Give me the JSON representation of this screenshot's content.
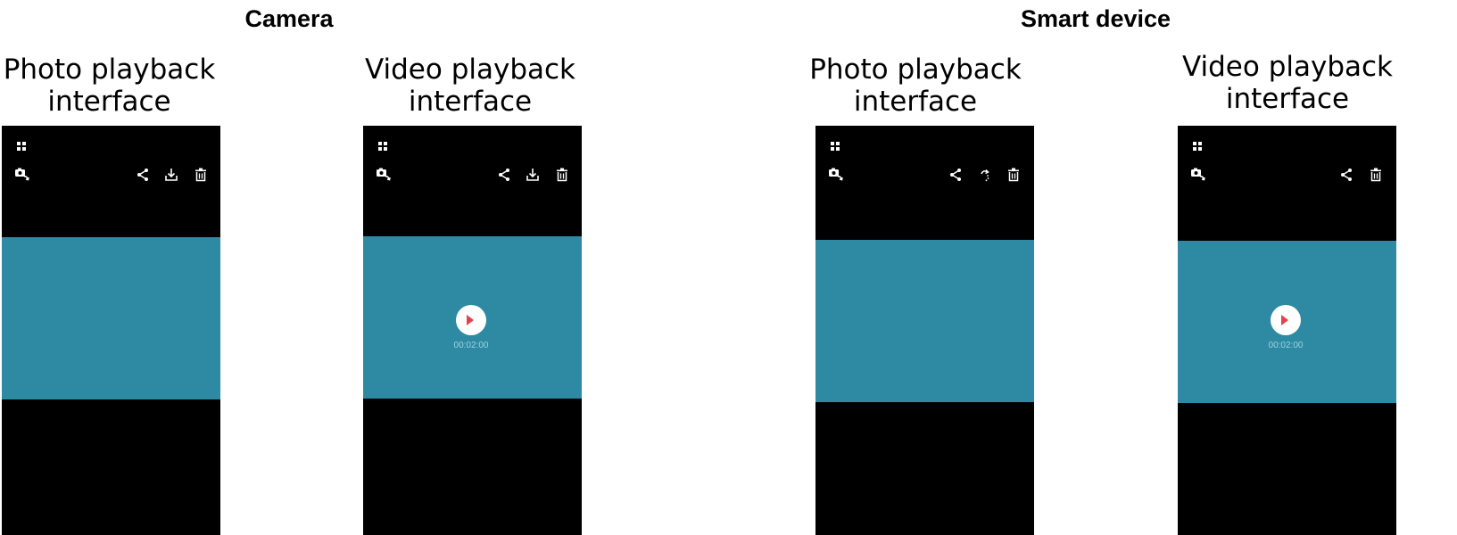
{
  "sections": {
    "camera": "Camera",
    "smart_device": "Smart device"
  },
  "panels": [
    {
      "title_line1": "Photo playback",
      "title_line2": "interface"
    },
    {
      "title_line1": "Video playback",
      "title_line2": "interface",
      "duration": "00:02:00"
    },
    {
      "title_line1": "Photo playback",
      "title_line2": "interface"
    },
    {
      "title_line1": "Video playback",
      "title_line2": "interface",
      "duration": "00:02:00"
    }
  ],
  "icons": {
    "grid": "grid-icon",
    "switch_camera": "camera-switch-icon",
    "share": "share-icon",
    "download": "download-icon",
    "rotate": "rotate-icon",
    "delete": "trash-icon",
    "play": "play-icon"
  },
  "colors": {
    "screen_background": "#000000",
    "media_area": "#2e8aa3",
    "play_button": "#ffffff",
    "play_arrow": "#e0444c",
    "duration_text": "#9ed2df"
  }
}
